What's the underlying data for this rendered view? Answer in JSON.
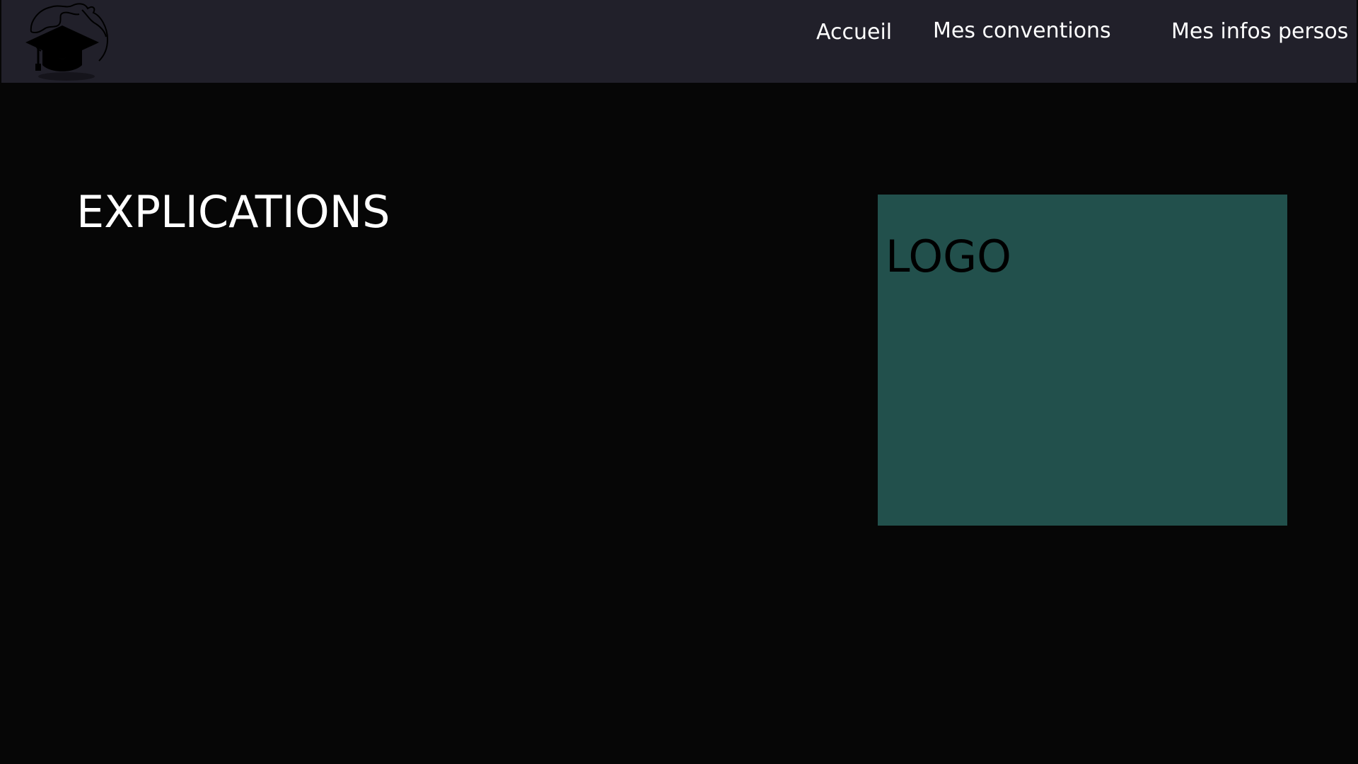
{
  "nav": {
    "logo_icon": "graduation-cap-globe-logo",
    "links": [
      {
        "label": "Accueil"
      },
      {
        "label": "Mes conventions"
      },
      {
        "label": "Mes infos persos"
      }
    ]
  },
  "main": {
    "heading": "EXPLICATIONS",
    "logo_placeholder": "LOGO"
  },
  "colors": {
    "navbar_bg": "#21202a",
    "page_bg": "#060606",
    "logo_box_bg": "#22504c",
    "text_light": "#ffffff",
    "text_dark": "#000000"
  }
}
